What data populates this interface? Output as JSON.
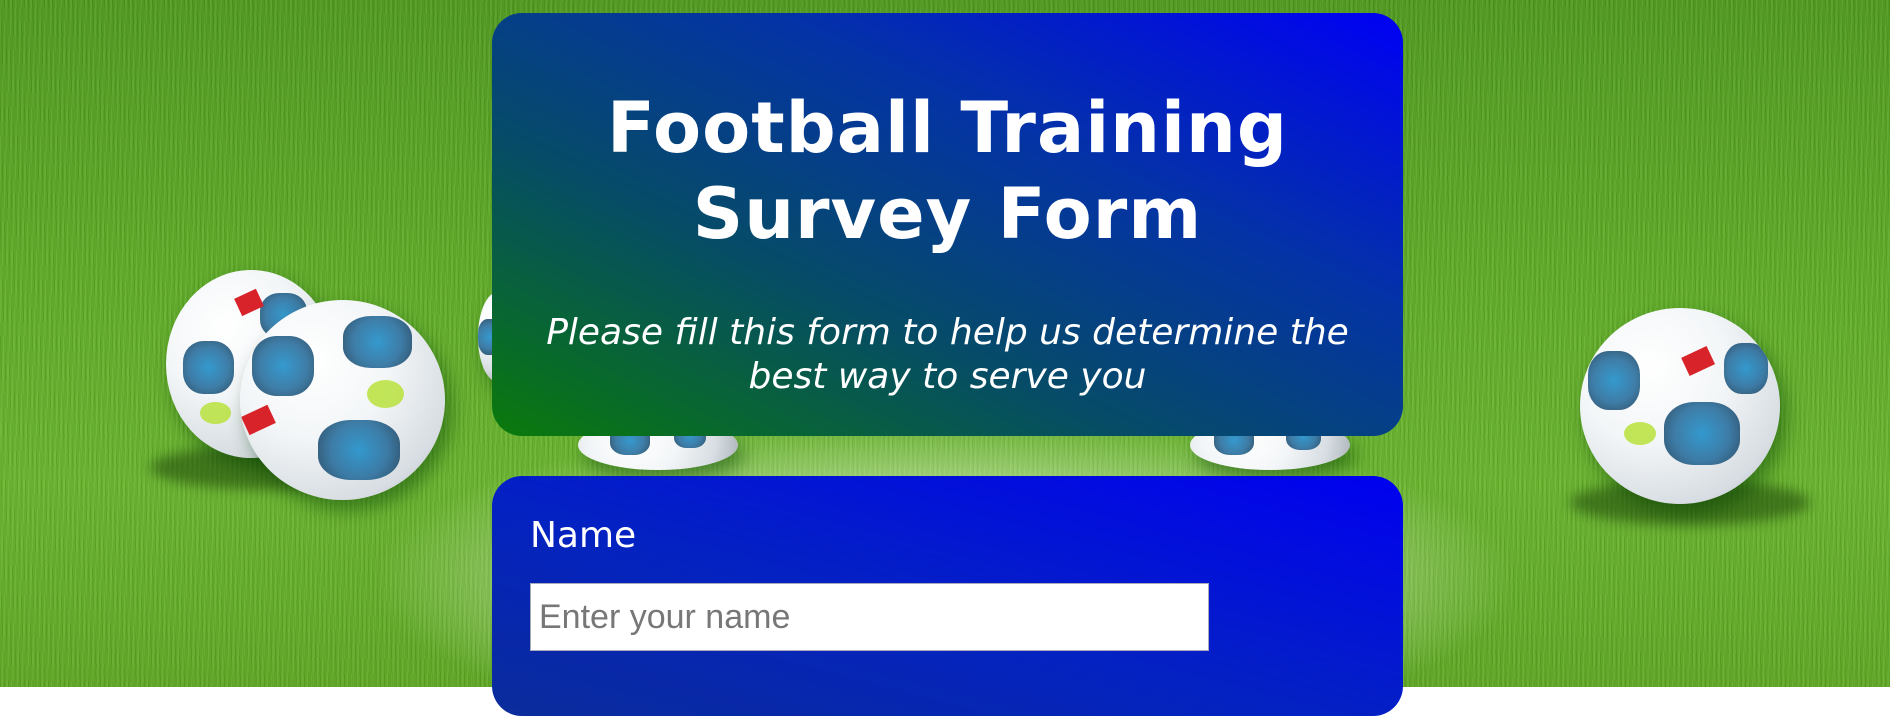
{
  "header": {
    "title": "Football Training Survey Form",
    "description": "Please fill this form to help us determine the best way to serve you"
  },
  "form": {
    "name_label": "Name",
    "name_placeholder": "Enter your name",
    "name_value": ""
  },
  "colors": {
    "header_gradient_start": "#0a7a0a",
    "header_gradient_end": "#0000f5",
    "form_background": "#0422c2",
    "text": "#ffffff",
    "field_background": "#ffffff"
  },
  "background": {
    "image": "football-pitch-with-balls"
  }
}
